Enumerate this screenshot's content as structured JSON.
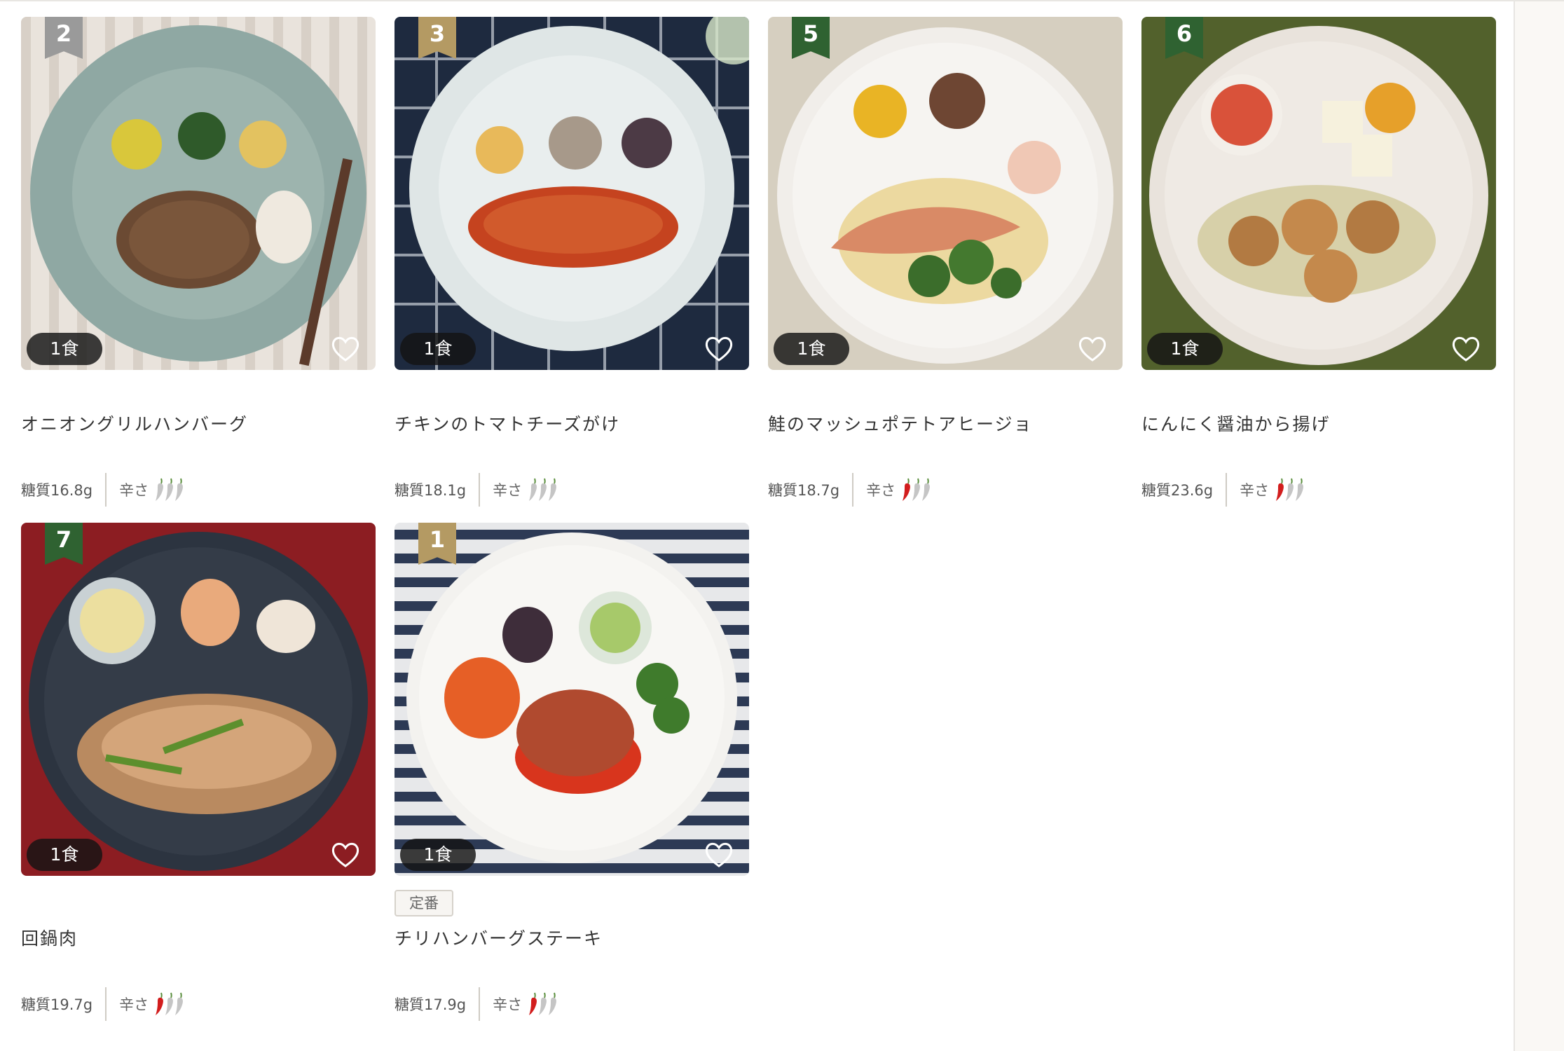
{
  "colors": {
    "rank_gold": "#b49a63",
    "rank_silver": "#9a9a9a",
    "rank_green": "#2f6231",
    "pepper_on": "#d21d1d",
    "pepper_off": "#c5c5c5",
    "pepper_stem": "#5b8f3e"
  },
  "icons": {
    "favorite": "heart-outline-icon",
    "spice": "chili-pepper-icon",
    "rank": "ranking-ribbon-icon"
  },
  "products": [
    {
      "rank": "2",
      "rank_style": "silver",
      "count": "1食",
      "name": "オニオングリルハンバーグ",
      "carbs": "糖質16.8g",
      "spice_label": "辛さ",
      "spice_level": 0,
      "spice_max": 3,
      "tag": ""
    },
    {
      "rank": "3",
      "rank_style": "gold",
      "count": "1食",
      "name": "チキンのトマトチーズがけ",
      "carbs": "糖質18.1g",
      "spice_label": "辛さ",
      "spice_level": 0,
      "spice_max": 3,
      "tag": ""
    },
    {
      "rank": "5",
      "rank_style": "green",
      "count": "1食",
      "name": "鮭のマッシュポテトアヒージョ",
      "carbs": "糖質18.7g",
      "spice_label": "辛さ",
      "spice_level": 1,
      "spice_max": 3,
      "tag": ""
    },
    {
      "rank": "6",
      "rank_style": "green",
      "count": "1食",
      "name": "にんにく醤油から揚げ",
      "carbs": "糖質23.6g",
      "spice_label": "辛さ",
      "spice_level": 1,
      "spice_max": 3,
      "tag": ""
    },
    {
      "rank": "7",
      "rank_style": "green",
      "count": "1食",
      "name": "回鍋肉",
      "carbs": "糖質19.7g",
      "spice_label": "辛さ",
      "spice_level": 1,
      "spice_max": 3,
      "tag": ""
    },
    {
      "rank": "1",
      "rank_style": "gold",
      "count": "1食",
      "name": "チリハンバーグステーキ",
      "carbs": "糖質17.9g",
      "spice_label": "辛さ",
      "spice_level": 1,
      "spice_max": 3,
      "tag": "定番"
    }
  ]
}
